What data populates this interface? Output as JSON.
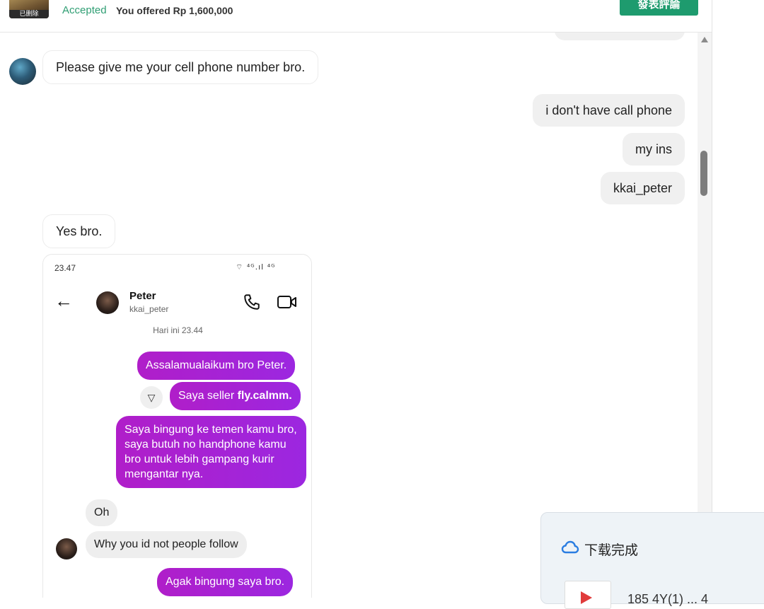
{
  "header": {
    "thumb_badge": "已删除",
    "offer_status": "Accepted",
    "offer_text": "You offered Rp 1,600,000",
    "review_button": "發表評論"
  },
  "messages": {
    "incoming_1": "Please give me your cell phone number bro.",
    "outgoing_1": "i don't have call phone",
    "outgoing_2": "my ins",
    "outgoing_3": "kkai_peter",
    "incoming_2": "Yes bro."
  },
  "screenshot": {
    "time": "23.47",
    "status_icons": "⌔ ⁴ᴳ.ıl ⁴ᴳ",
    "contact_name": "Peter",
    "contact_handle": "kkai_peter",
    "date_label": "Hari ini 23.44",
    "sent": [
      "Assalamualaikum bro Peter.",
      "Saya seller fly.calmm.",
      "Saya bingung ke temen kamu bro, saya butuh no handphone kamu bro untuk lebih gampang kurir mengantar nya.",
      "Agak bingung saya bro."
    ],
    "received": [
      "Oh",
      "Why you id not people follow"
    ]
  },
  "download_popup": {
    "title": "下载完成",
    "file_name": "185 4Y(1) ... 4"
  },
  "icons": {
    "cloud": "cloud-icon",
    "call": "phone-icon",
    "video": "video-icon",
    "back": "back-arrow-icon"
  },
  "colors": {
    "accent_green": "#1e9b6e",
    "accepted_green": "#2f9e73",
    "sent_bubble_purple": "#a223d6",
    "outgoing_bubble": "#f0f0f0"
  }
}
